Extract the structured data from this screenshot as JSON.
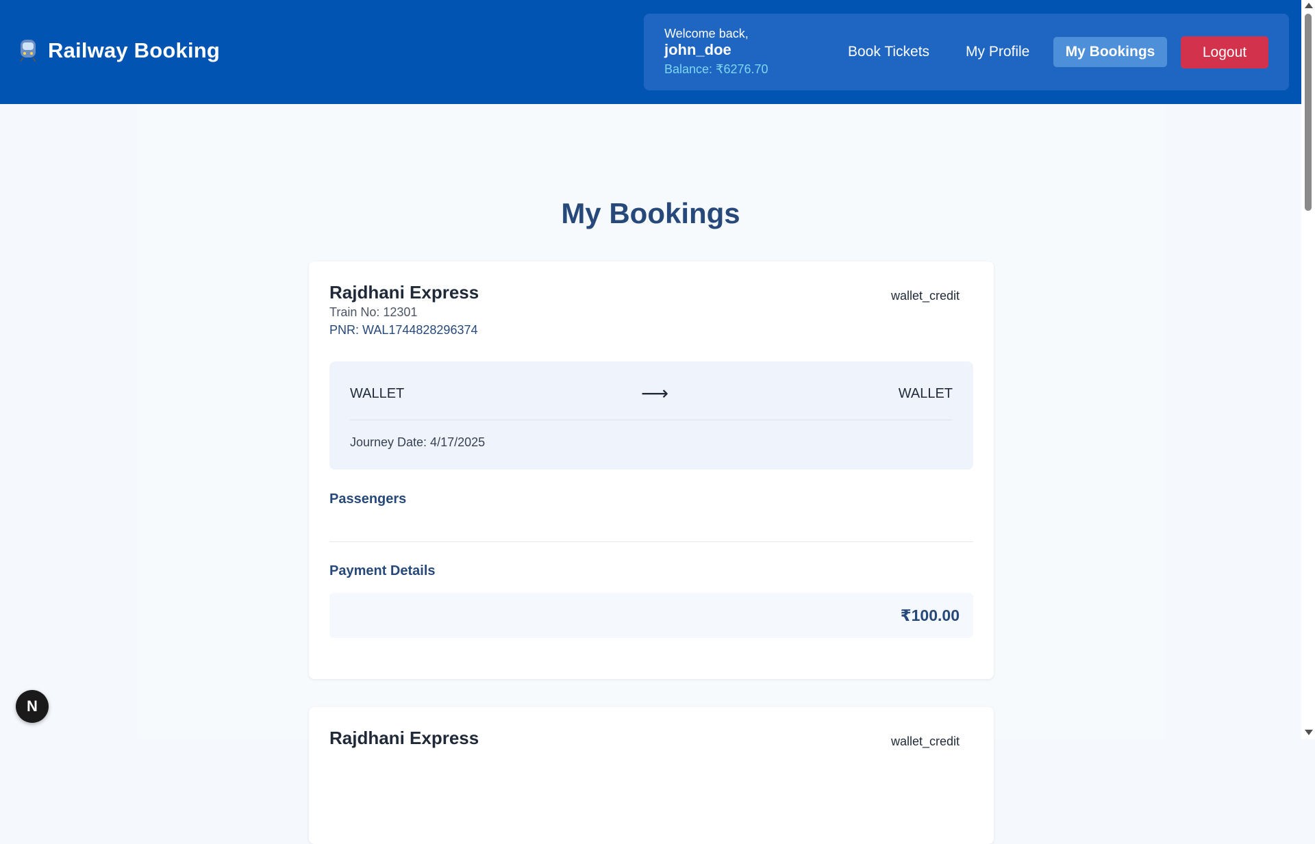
{
  "header": {
    "brand_title": "Railway Booking",
    "welcome_text": "Welcome back,",
    "username": "john_doe",
    "balance": "Balance: ₹6276.70",
    "nav": {
      "book_tickets": "Book Tickets",
      "my_profile": "My Profile",
      "my_bookings": "My Bookings",
      "logout": "Logout"
    }
  },
  "page": {
    "title": "My Bookings"
  },
  "bookings": [
    {
      "train_name": "Rajdhani Express",
      "train_no": "Train No: 12301",
      "pnr": "PNR: WAL1744828296374",
      "payment_type": "wallet_credit",
      "from": "WALLET",
      "arrow": "⟶",
      "to": "WALLET",
      "journey_date": "Journey Date: 4/17/2025",
      "passengers_heading": "Passengers",
      "payment_heading": "Payment Details",
      "amount": "₹100.00"
    },
    {
      "train_name": "Rajdhani Express",
      "payment_type": "wallet_credit"
    }
  ],
  "floating_badge": {
    "label": "N"
  },
  "colors": {
    "header_bg": "#0254b2",
    "user_panel_bg": "#1f66c2",
    "active_nav_bg": "#4e8fd9",
    "logout_bg": "#d3324d",
    "heading_blue": "#27497a",
    "balance_text": "#7fd6f4"
  },
  "icons": {
    "brand": "train-icon",
    "route": "arrow-right-icon"
  }
}
